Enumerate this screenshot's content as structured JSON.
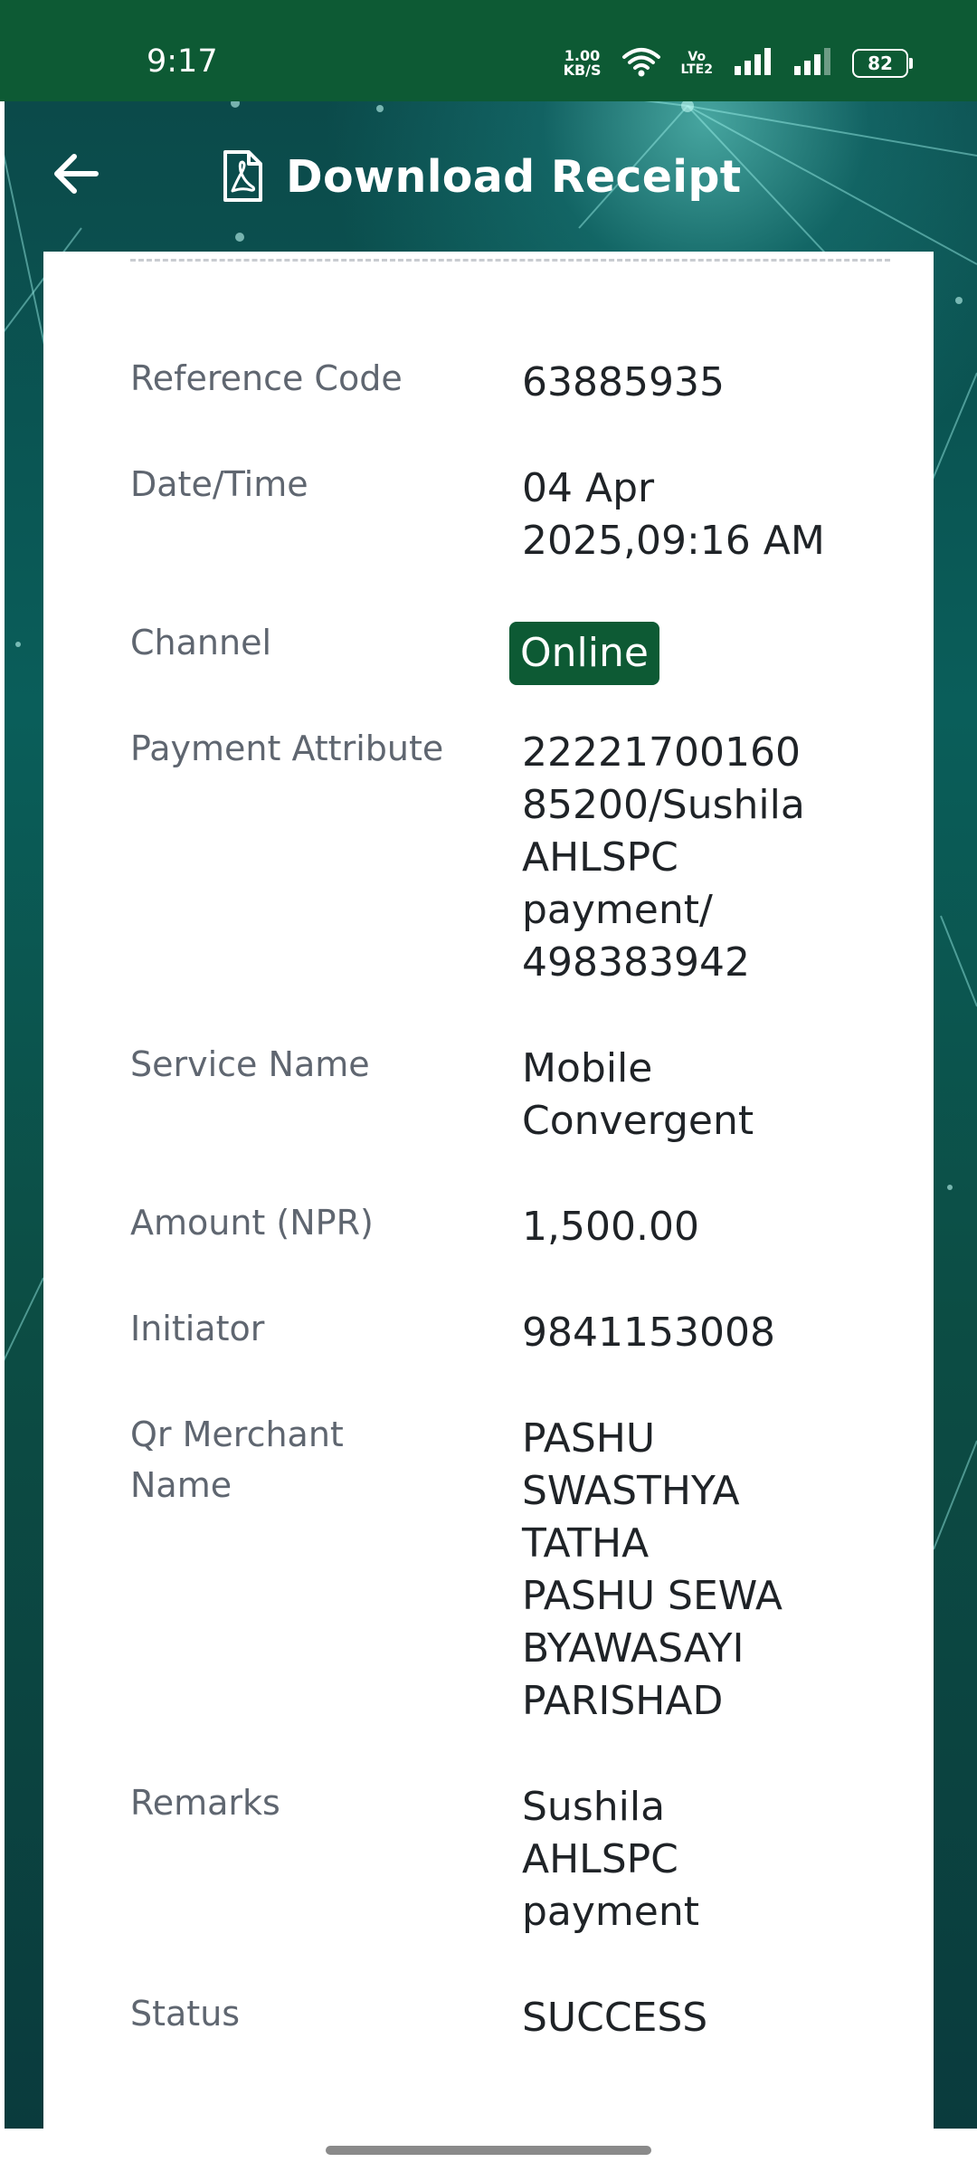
{
  "status_bar": {
    "time": "9:17",
    "net_speed_value": "1.00",
    "net_speed_unit": "KB/S",
    "volte_top": "Vo",
    "volte_bottom": "LTE2",
    "battery": "82",
    "icons": [
      "wifi-icon",
      "signal-icon",
      "signal-icon",
      "battery-icon"
    ]
  },
  "header": {
    "title": "Download Receipt",
    "back_icon": "arrow-left-icon",
    "title_icon": "pdf-file-icon"
  },
  "receipt": {
    "fields": [
      {
        "label": "Reference Code",
        "value": "63885935"
      },
      {
        "label": "Date/Time",
        "value_lines": [
          "04 Apr",
          "2025,09:16 AM"
        ]
      },
      {
        "label": "Channel",
        "value": "Online",
        "style": "badge"
      },
      {
        "label": "Payment Attribute",
        "value_lines": [
          "22221700160",
          "85200/Sushila",
          "AHLSPC",
          "payment/",
          "498383942"
        ]
      },
      {
        "label": "Service Name",
        "value_lines": [
          "Mobile",
          "Convergent"
        ]
      },
      {
        "label": "Amount (NPR)",
        "value": "1,500.00"
      },
      {
        "label": "Initiator",
        "value": "9841153008"
      },
      {
        "label_lines": [
          "Qr Merchant",
          "Name"
        ],
        "value_lines": [
          "PASHU",
          "SWASTHYA",
          "TATHA",
          "PASHU SEWA",
          "BYAWASAYI",
          "PARISHAD"
        ]
      },
      {
        "label": "Remarks",
        "value_lines": [
          "Sushila",
          "AHLSPC",
          "payment"
        ]
      },
      {
        "label": "Status",
        "value": "SUCCESS"
      }
    ]
  },
  "colors": {
    "brand_green": "#0d5a34",
    "label_gray": "#5f6670",
    "value_text": "#1f2327"
  }
}
